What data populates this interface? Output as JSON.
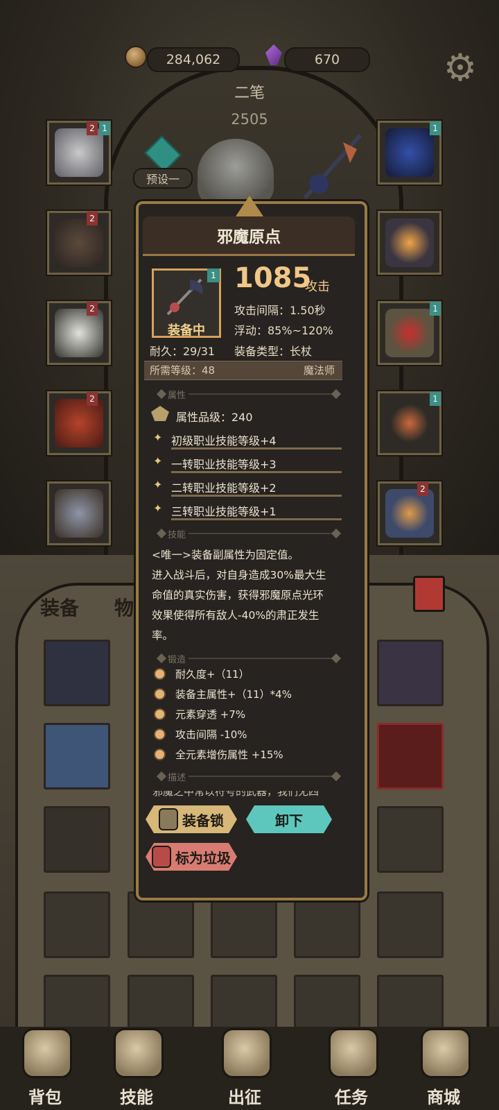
{
  "currency": {
    "coins": "284,062",
    "gems": "670"
  },
  "character": {
    "name": "二笔",
    "power": "2505",
    "preset": "预设一"
  },
  "popup": {
    "title": "邪魔原点",
    "badge": "1",
    "status": "装备中",
    "attack_value": "1085",
    "attack_unit": "攻击",
    "attack_interval": "攻击间隔：1.50秒",
    "float_range": "浮动：85%~120%",
    "durability": "耐久：29/31",
    "equip_type": "装备类型：长杖",
    "required_level": "所需等级：48",
    "required_class": "魔法师",
    "sections": {
      "attributes": "属性",
      "skills": "技能",
      "forge": "锻造",
      "description": "描述"
    },
    "attribute_grade": "属性品级：240",
    "affixes": [
      "初级职业技能等级+4",
      "一转职业技能等级+3",
      "二转职业技能等级+2",
      "三转职业技能等级+1"
    ],
    "skill_text": [
      "<唯一>装备副属性为固定值。",
      "进入战斗后，对自身造成30%最大生",
      "命值的真实伤害，获得邪魔原点光环",
      "效果使得所有敌人-40%的肃正发生",
      "率。"
    ],
    "forge_items": [
      "耐久度+（11）",
      "装备主属性+（11）*4%",
      "元素穿透 +7%",
      "攻击间隔 -10%",
      "全元素增伤属性 +15%"
    ],
    "lore_text": "邪魔之中常以符号的武器，我们无四",
    "buttons": {
      "lock": "装备锁",
      "unequip": "卸下",
      "mark_trash": "标为垃圾"
    }
  },
  "bag_tabs": {
    "equipment": "装备",
    "items": "物品"
  },
  "nav": {
    "bag": "背包",
    "skills": "技能",
    "expedition": "出征",
    "tasks": "任务",
    "shop": "商城"
  },
  "colors": {
    "accent_gold": "#d7b879",
    "accent_teal": "#5ec7bd",
    "trash_red": "#d87c72"
  }
}
